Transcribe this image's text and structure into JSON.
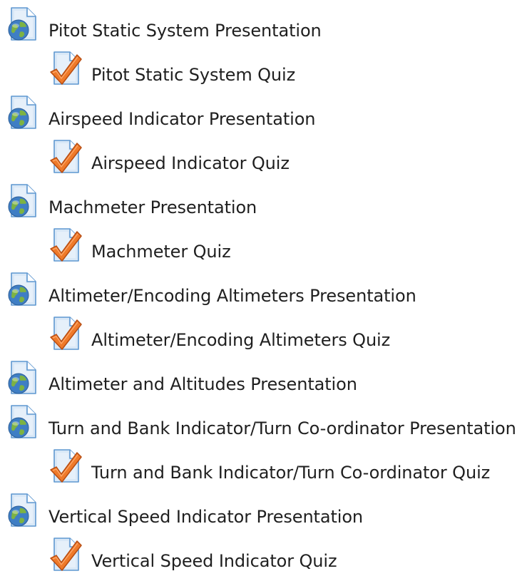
{
  "activities": [
    {
      "type": "presentation",
      "icon": "page-globe-icon",
      "label": "Pitot Static System Presentation"
    },
    {
      "type": "quiz",
      "icon": "quiz-checkmark-icon",
      "label": "Pitot Static System Quiz"
    },
    {
      "type": "presentation",
      "icon": "page-globe-icon",
      "label": "Airspeed Indicator Presentation"
    },
    {
      "type": "quiz",
      "icon": "quiz-checkmark-icon",
      "label": "Airspeed Indicator Quiz"
    },
    {
      "type": "presentation",
      "icon": "page-globe-icon",
      "label": "Machmeter Presentation"
    },
    {
      "type": "quiz",
      "icon": "quiz-checkmark-icon",
      "label": "Machmeter Quiz"
    },
    {
      "type": "presentation",
      "icon": "page-globe-icon",
      "label": "Altimeter/Encoding Altimeters Presentation"
    },
    {
      "type": "quiz",
      "icon": "quiz-checkmark-icon",
      "label": "Altimeter/Encoding Altimeters Quiz"
    },
    {
      "type": "presentation",
      "icon": "page-globe-icon",
      "label": "Altimeter and Altitudes Presentation"
    },
    {
      "type": "presentation",
      "icon": "page-globe-icon",
      "label": "Turn and Bank Indicator/Turn Co-ordinator Presentation"
    },
    {
      "type": "quiz",
      "icon": "quiz-checkmark-icon",
      "label": "Turn and Bank Indicator/Turn Co-ordinator Quiz"
    },
    {
      "type": "presentation",
      "icon": "page-globe-icon",
      "label": "Vertical Speed Indicator Presentation"
    },
    {
      "type": "quiz",
      "icon": "quiz-checkmark-icon",
      "label": "Vertical Speed Indicator Quiz"
    }
  ],
  "colors": {
    "text": "#1f1f1f",
    "page_fill": "#d9e8f7",
    "page_stroke": "#5e97d0",
    "globe_blue": "#3f7ec4",
    "globe_green": "#7db342",
    "check_orange": "#ef7a2a",
    "check_stroke": "#b84d12"
  }
}
